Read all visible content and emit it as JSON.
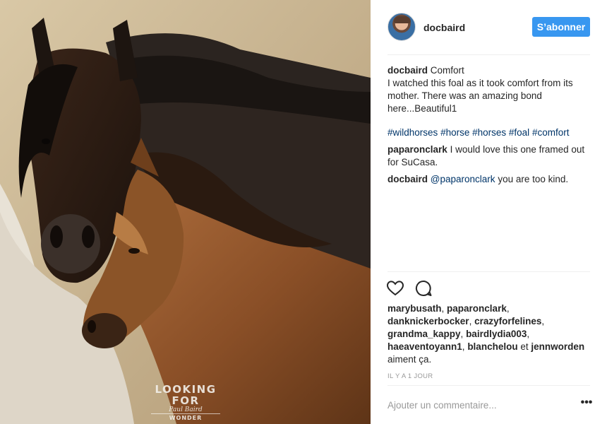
{
  "header": {
    "username": "docbaird",
    "follow_label": "S’abonner"
  },
  "caption": {
    "username": "docbaird",
    "title": "Comfort",
    "text": "I watched this foal as it took comfort from its mother. There was an amazing bond here...Beautiful1",
    "hashtags": [
      "#wildhorses",
      "#horse",
      "#horses",
      "#foal",
      "#comfort"
    ]
  },
  "comments": [
    {
      "username": "paparonclark",
      "text": "I would love this one framed out for SuCasa."
    },
    {
      "username": "docbaird",
      "mention": "@paparonclark",
      "text": "you are too kind."
    }
  ],
  "likes": {
    "names": [
      "marybusath",
      "paparonclark",
      "danknickerbocker",
      "crazyforfelines",
      "grandma_kappy",
      "bairdlydia003",
      "haeaventoyann1",
      "blanchelou",
      "jennworden"
    ],
    "connector": "et",
    "suffix": "aiment ça."
  },
  "timestamp": "IL Y A 1 JOUR",
  "comment_input": {
    "placeholder": "Ajouter un commentaire..."
  },
  "more_label": "•••",
  "watermark": {
    "top": "LOOKING FOR",
    "signature": "Paul Baird",
    "bottom": "WONDER PHOTOGRAPHY"
  },
  "icons": {
    "like": "heart-outline-icon",
    "comment": "speech-bubble-icon",
    "more": "ellipsis-icon"
  },
  "colors": {
    "accent": "#3897f0",
    "link": "#003569",
    "muted": "#999999",
    "text": "#262626"
  }
}
